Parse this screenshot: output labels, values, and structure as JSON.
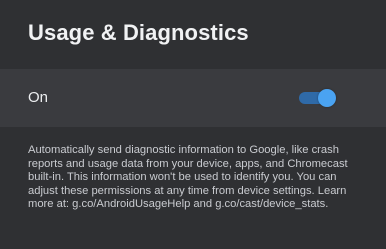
{
  "page": {
    "title": "Usage & Diagnostics"
  },
  "setting": {
    "label": "On",
    "toggle_state": "on"
  },
  "description": {
    "text": "Automatically send diagnostic information to Google, like crash reports and usage data from your device, apps, and Chromecast built-in. This information won't be used to identify you. You can adjust these permissions at any time from device settings. Learn more at: g.co/AndroidUsageHelp and g.co/cast/device_stats."
  },
  "colors": {
    "background": "#2f3033",
    "row_background": "#3a3b3f",
    "toggle_accent": "#4aa3f2"
  },
  "icons": {
    "toggle": "toggle-switch-icon"
  }
}
